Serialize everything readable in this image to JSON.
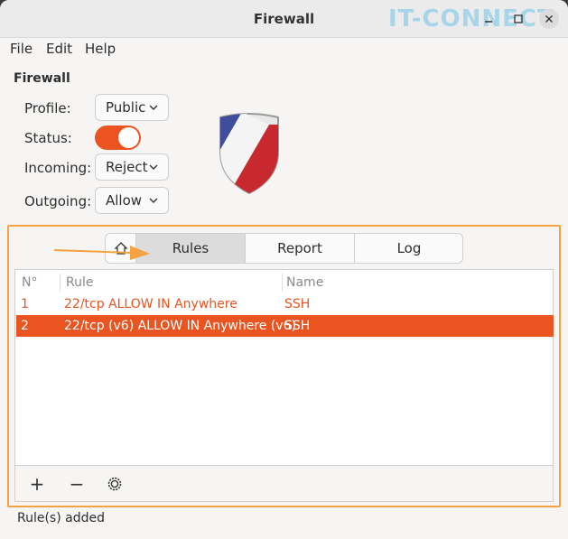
{
  "window": {
    "title": "Firewall",
    "watermark": "IT-CONNECT"
  },
  "menu": [
    "File",
    "Edit",
    "Help"
  ],
  "section_title": "Firewall",
  "fields": {
    "profile": {
      "label": "Profile:",
      "value": "Public"
    },
    "status": {
      "label": "Status:",
      "enabled": true
    },
    "incoming": {
      "label": "Incoming:",
      "value": "Reject"
    },
    "outgoing": {
      "label": "Outgoing:",
      "value": "Allow"
    }
  },
  "tabs": [
    "Rules",
    "Report",
    "Log"
  ],
  "active_tab": "Rules",
  "table": {
    "columns": [
      "N°",
      "Rule",
      "Name"
    ],
    "rows": [
      {
        "n": "1",
        "rule": "22/tcp ALLOW IN Anywhere",
        "name": "SSH",
        "selected": false
      },
      {
        "n": "2",
        "rule": "22/tcp (v6) ALLOW IN Anywhere (v6)",
        "name": "SSH",
        "selected": true
      }
    ]
  },
  "toolbar": {
    "add": "+",
    "remove": "−"
  },
  "statusbar": "Rule(s) added",
  "colors": {
    "accent": "#e95420",
    "highlight": "#f4a340"
  }
}
